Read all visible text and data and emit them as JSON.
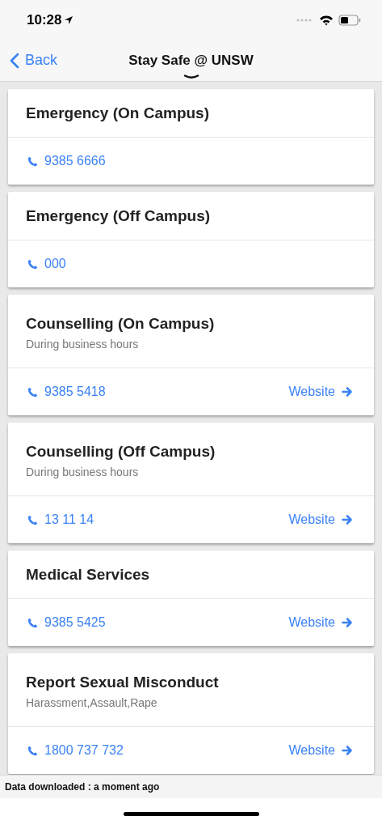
{
  "status_bar": {
    "time": "10:28"
  },
  "nav": {
    "back": "Back",
    "title": "Stay Safe @ UNSW"
  },
  "cards": [
    {
      "title": "Emergency (On Campus)",
      "phone": "9385 6666"
    },
    {
      "title": "Emergency (Off Campus)",
      "phone": "000"
    },
    {
      "title": "Counselling (On Campus)",
      "subtitle": "During business hours",
      "phone": "9385 5418",
      "website": "Website"
    },
    {
      "title": "Counselling (Off Campus)",
      "subtitle": "During business hours",
      "phone": "13 11 14",
      "website": "Website"
    },
    {
      "title": "Medical Services",
      "phone": "9385 5425",
      "website": "Website"
    },
    {
      "title": "Report Sexual Misconduct",
      "subtitle": "Harassment,Assault,Rape",
      "phone": "1800 737 732",
      "website": "Website"
    }
  ],
  "footer": {
    "text": "Data downloaded : a moment ago"
  }
}
